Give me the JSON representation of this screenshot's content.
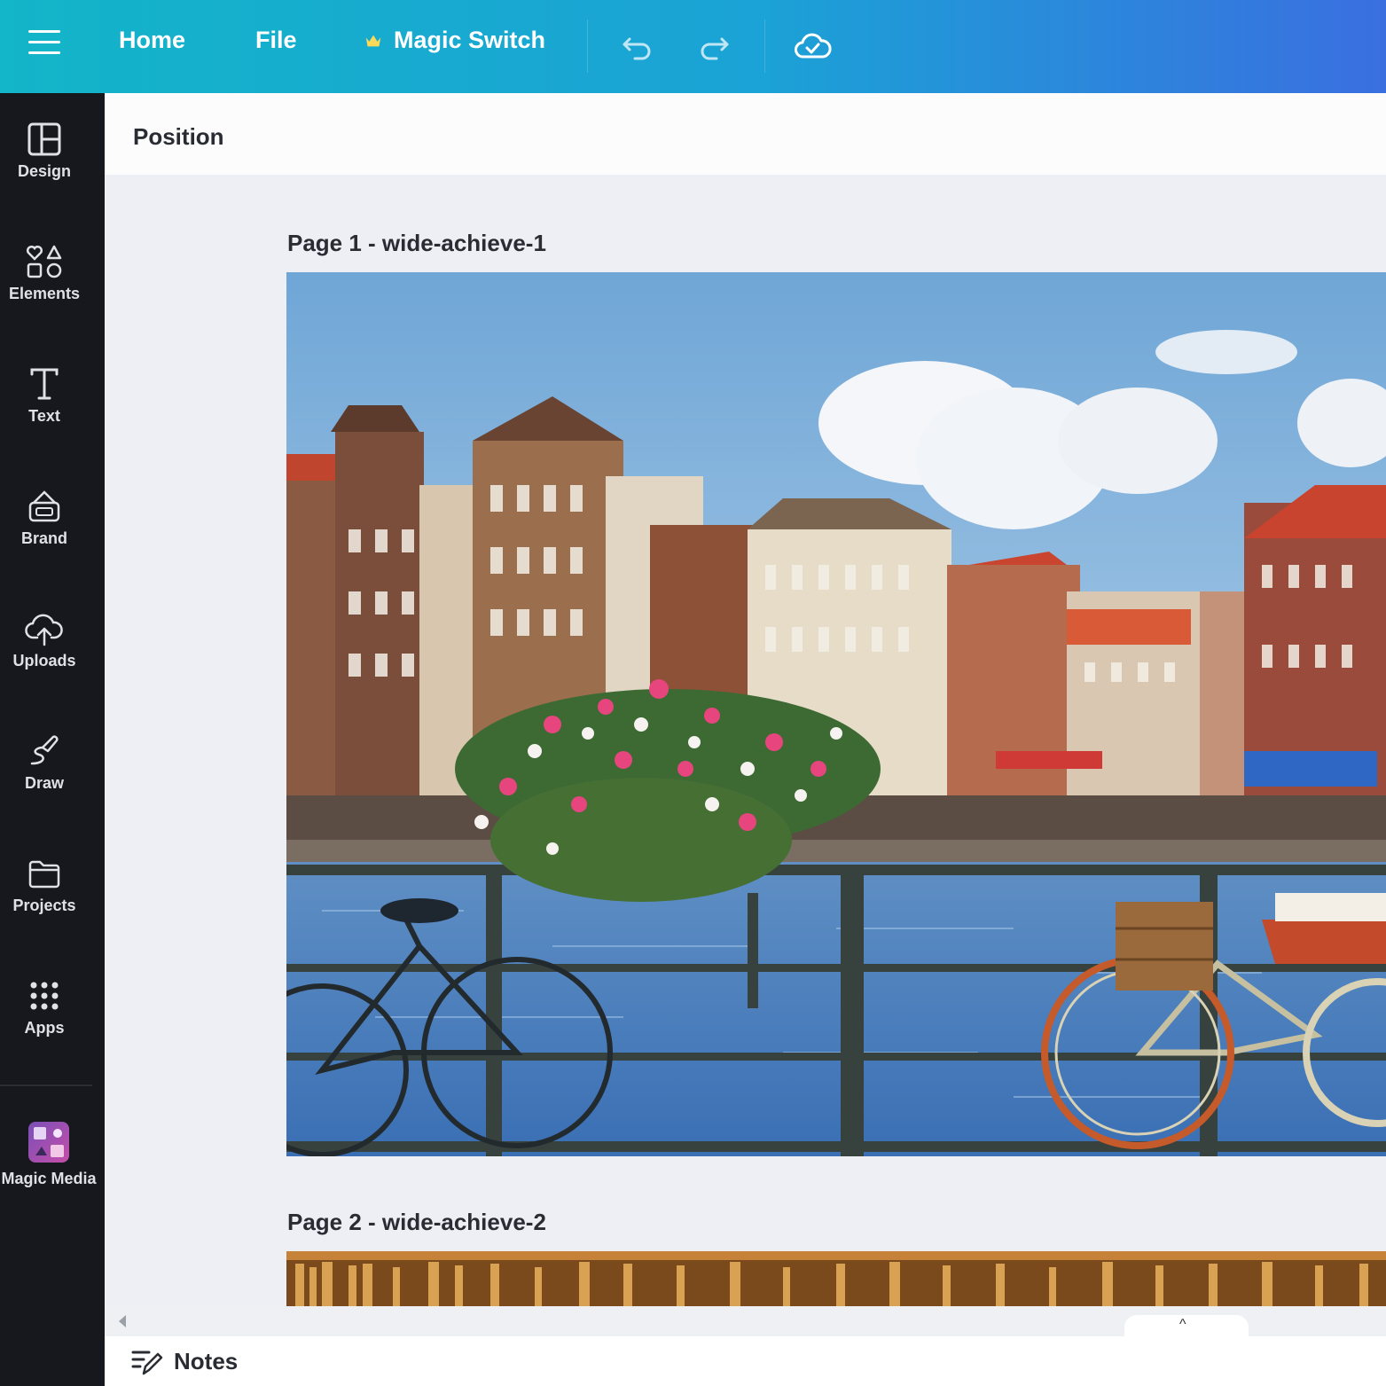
{
  "topbar": {
    "home_label": "Home",
    "file_label": "File",
    "magic_switch_label": "Magic Switch",
    "gradient_start": "#13b5c8",
    "gradient_end": "#3a6fe0"
  },
  "sidebar": {
    "items": [
      {
        "label": "Design",
        "icon": "design-icon"
      },
      {
        "label": "Elements",
        "icon": "elements-icon"
      },
      {
        "label": "Text",
        "icon": "text-icon"
      },
      {
        "label": "Brand",
        "icon": "brand-icon"
      },
      {
        "label": "Uploads",
        "icon": "uploads-icon"
      },
      {
        "label": "Draw",
        "icon": "draw-icon"
      },
      {
        "label": "Projects",
        "icon": "projects-icon"
      },
      {
        "label": "Apps",
        "icon": "apps-icon"
      },
      {
        "label": "Magic Media",
        "icon": "magic-media-icon"
      }
    ]
  },
  "toolbar": {
    "position_label": "Position"
  },
  "pages": [
    {
      "title": "Page 1 - wide-achieve-1"
    },
    {
      "title": "Page 2 - wide-achieve-2"
    }
  ],
  "footer": {
    "notes_label": "Notes",
    "collapse_glyph": "^"
  }
}
